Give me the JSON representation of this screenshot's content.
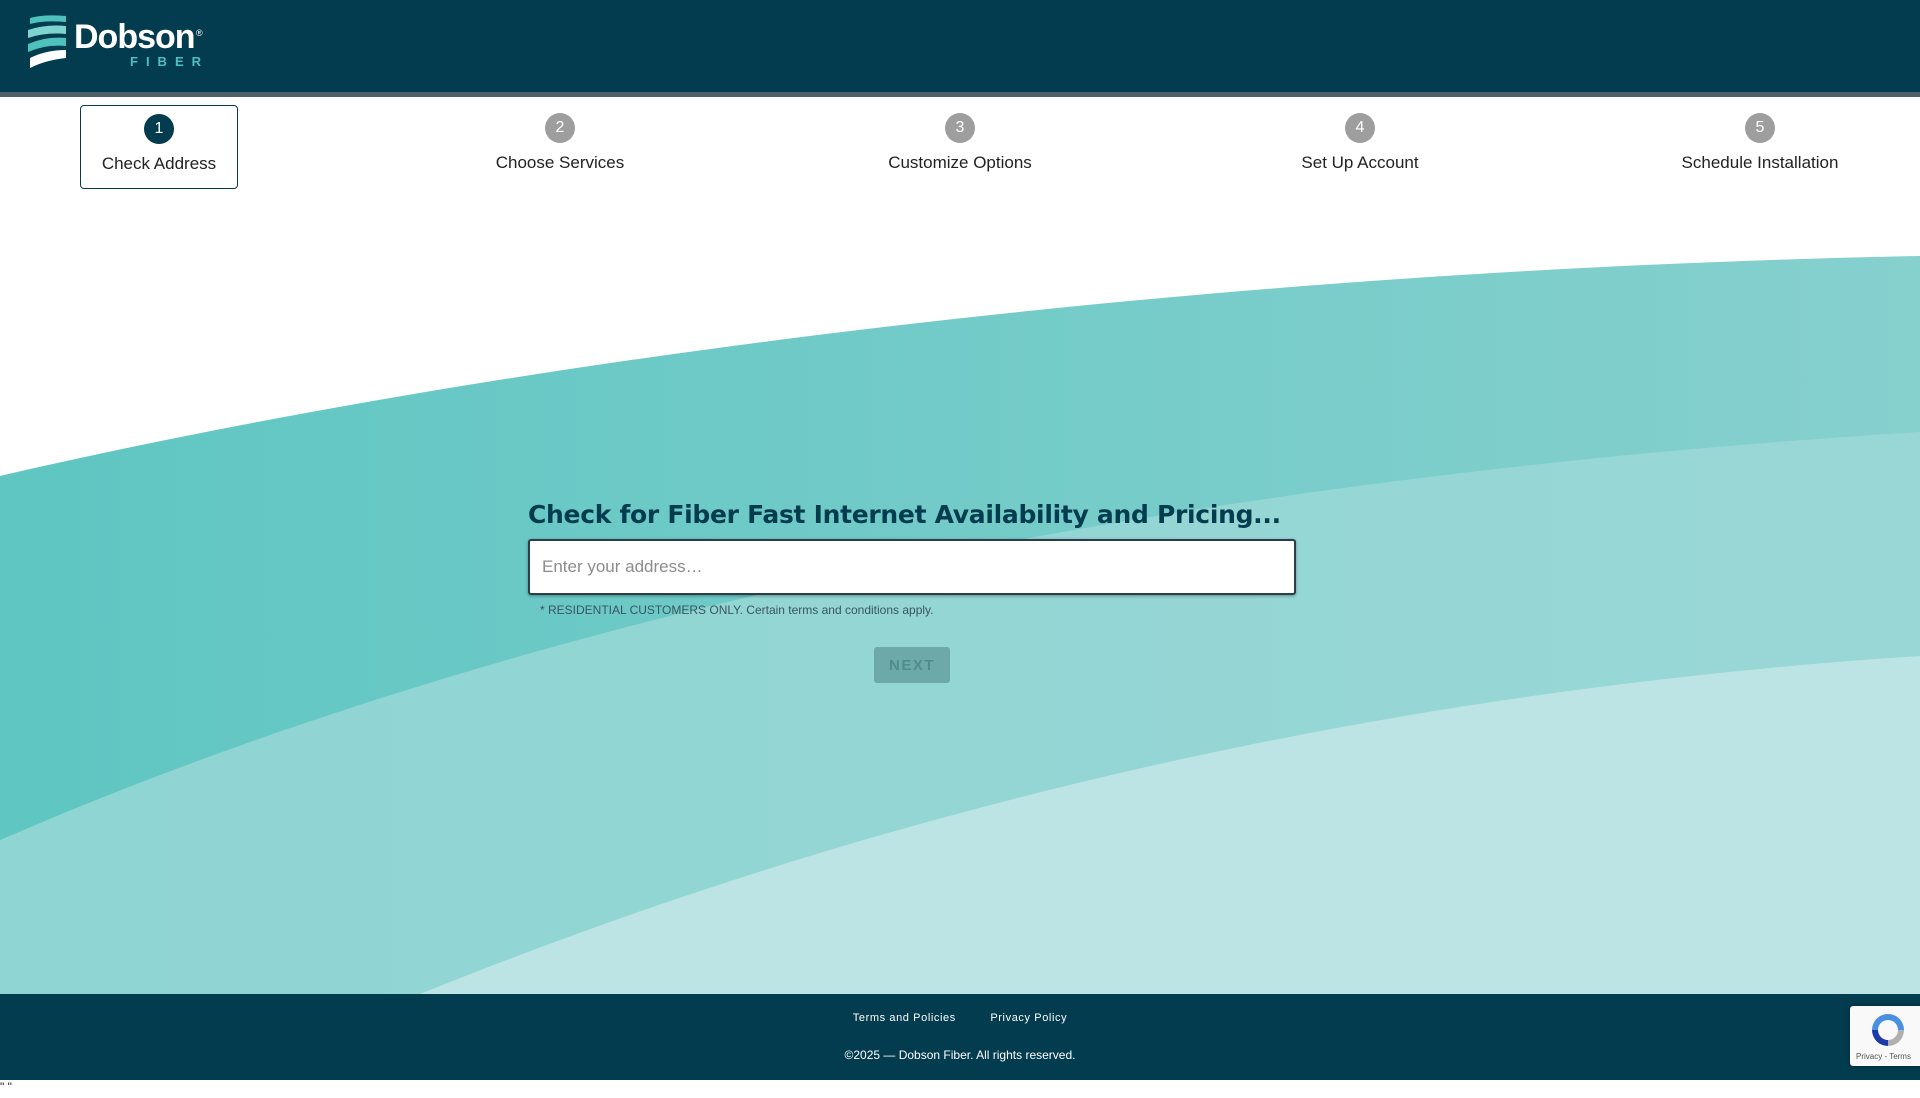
{
  "brand": {
    "name": "Dobson",
    "sub": "FIBER",
    "reg": "®",
    "colors": {
      "primary": "#033b4f",
      "teal": "#4fc1bd",
      "inactive_step": "#9e9e9e"
    }
  },
  "stepper": {
    "steps": [
      {
        "number": "1",
        "label": "Check Address",
        "active": true
      },
      {
        "number": "2",
        "label": "Choose Services",
        "active": false
      },
      {
        "number": "3",
        "label": "Customize Options",
        "active": false
      },
      {
        "number": "4",
        "label": "Set Up Account",
        "active": false
      },
      {
        "number": "5",
        "label": "Schedule Installation",
        "active": false
      }
    ]
  },
  "form": {
    "headline": "Check for Fiber Fast Internet Availability and Pricing...",
    "address_value": "",
    "address_placeholder": "Enter your address…",
    "disclaimer": "* RESIDENTIAL CUSTOMERS ONLY. Certain terms and conditions apply.",
    "next_label": "NEXT",
    "next_enabled": false
  },
  "footer": {
    "links": [
      "Terms and Policies",
      "Privacy Policy"
    ],
    "copyright": "©2025 — Dobson Fiber. All rights reserved."
  },
  "recaptcha": {
    "label": "Privacy - Terms",
    "icon": "recaptcha-icon"
  },
  "stray_text": "\" \""
}
